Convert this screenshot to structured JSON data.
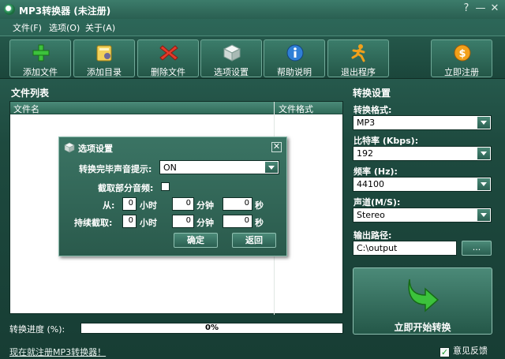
{
  "window": {
    "title": "MP3转换器 (未注册)",
    "help": "?",
    "minimize": "—",
    "close": "✕"
  },
  "menu": [
    {
      "label": "文件(F)"
    },
    {
      "label": "选项(O)"
    },
    {
      "label": "关于(A)"
    }
  ],
  "toolbar": [
    {
      "label": "添加文件",
      "icon": "add-file-icon"
    },
    {
      "label": "添加目录",
      "icon": "add-folder-icon"
    },
    {
      "label": "删除文件",
      "icon": "delete-file-icon"
    },
    {
      "label": "选项设置",
      "icon": "options-cube-icon"
    },
    {
      "label": "帮助说明",
      "icon": "info-icon"
    },
    {
      "label": "退出程序",
      "icon": "exit-runner-icon"
    },
    {
      "label": "立即注册",
      "icon": "register-coin-icon"
    }
  ],
  "file_list": {
    "title": "文件列表",
    "columns": [
      "文件名",
      "文件格式"
    ]
  },
  "settings": {
    "title": "转换设置",
    "format": {
      "label": "转换格式:",
      "value": "MP3"
    },
    "bitrate": {
      "label": "比特率 (Kbps):",
      "value": "192"
    },
    "frequency": {
      "label": "频率 (Hz):",
      "value": "44100"
    },
    "channel": {
      "label": "声道(M/S):",
      "value": "Stereo"
    },
    "output": {
      "label": "输出路径:",
      "value": "C:\\output",
      "browse": "..."
    },
    "start_button": "立即开始转换"
  },
  "progress": {
    "label": "转换进度 (%):",
    "value": 0,
    "text": "0%"
  },
  "footer": {
    "register_link": "现在就注册MP3转换器！",
    "feedback": "意见反馈"
  },
  "dialog": {
    "title": "选项设置",
    "close": "✕",
    "sound_label": "转换完毕声音提示:",
    "sound_value": "ON",
    "partial_label": "截取部分音频:",
    "from_label": "从:",
    "duration_label": "持续截取:",
    "from": {
      "hours": "0",
      "minutes": "0",
      "seconds": "0"
    },
    "duration": {
      "hours": "0",
      "minutes": "0",
      "seconds": "0"
    },
    "units": {
      "hours": "小时",
      "minutes": "分钟",
      "seconds": "秒"
    },
    "ok": "确定",
    "back": "返回"
  },
  "colors": {
    "accent": "#2f6b5c",
    "progress": "#3aa36b"
  }
}
